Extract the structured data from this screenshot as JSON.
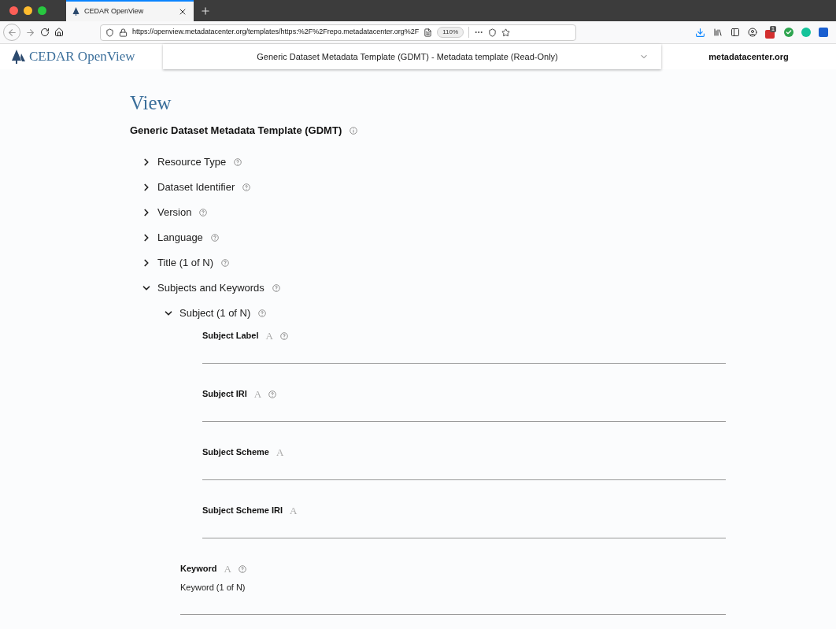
{
  "browser": {
    "tab": {
      "title": "CEDAR OpenView",
      "selected": true
    },
    "url": "https://openview.metadatacenter.org/templates/https:%2F%2Frepo.metadatacenter.org%2F",
    "zoom": "110%",
    "extension_badge": "1"
  },
  "header": {
    "logo": "CEDAR OpenView",
    "template_select": "Generic Dataset Metadata Template (GDMT) - Metadata template (Read-Only)",
    "site_link": "metadatacenter.org"
  },
  "page": {
    "heading": "View",
    "template_title": "Generic Dataset Metadata Template (GDMT)",
    "sections": [
      {
        "kind": "section",
        "label": "Resource Type",
        "expanded": false,
        "help": true
      },
      {
        "kind": "section",
        "label": "Dataset Identifier",
        "expanded": false,
        "help": true
      },
      {
        "kind": "section",
        "label": "Version",
        "expanded": false,
        "help": true
      },
      {
        "kind": "section",
        "label": "Language",
        "expanded": false,
        "help": true
      },
      {
        "kind": "section",
        "label": "Title (1 of N)",
        "expanded": false,
        "help": true
      },
      {
        "kind": "section",
        "label": "Subjects and Keywords",
        "expanded": true,
        "help": true,
        "children": [
          {
            "kind": "section",
            "label": "Subject (1 of N)",
            "expanded": true,
            "help": true,
            "children": [
              {
                "kind": "field",
                "label": "Subject Label",
                "type_glyph": "A",
                "help": true
              },
              {
                "kind": "field",
                "label": "Subject IRI",
                "type_glyph": "A",
                "help": true
              },
              {
                "kind": "field",
                "label": "Subject Scheme",
                "type_glyph": "A",
                "help": false
              },
              {
                "kind": "field",
                "label": "Subject Scheme IRI",
                "type_glyph": "A",
                "help": false
              }
            ]
          },
          {
            "kind": "field",
            "label": "Keyword",
            "type_glyph": "A",
            "help": true,
            "instance_label": "Keyword (1 of N)"
          }
        ]
      }
    ]
  }
}
